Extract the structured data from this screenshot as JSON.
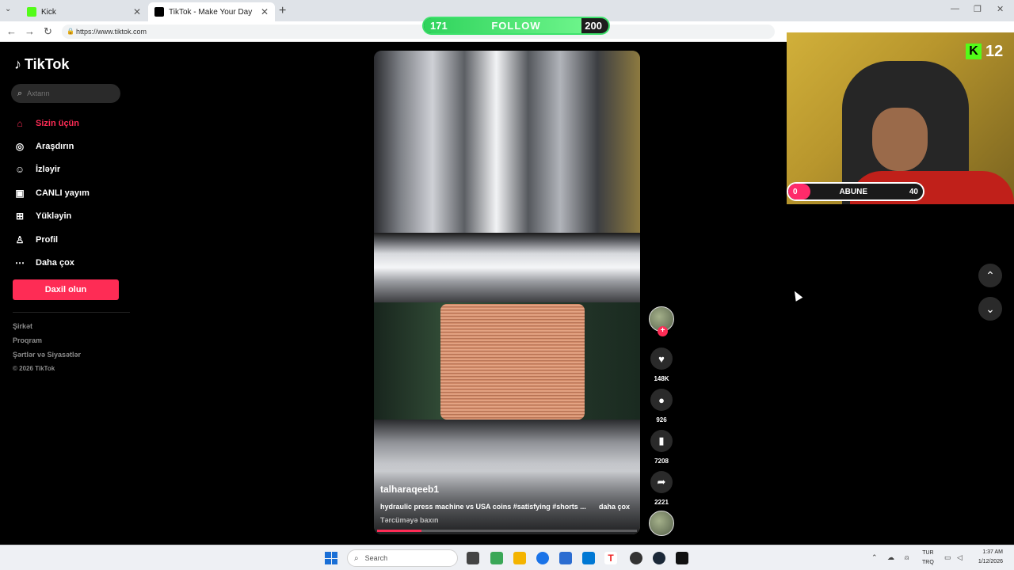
{
  "browser": {
    "tabs": [
      {
        "title": "Kick"
      },
      {
        "title": "TikTok - Make Your Day"
      }
    ],
    "url": "https://www.tiktok.com"
  },
  "follow_goal": {
    "current": "171",
    "label": "FOLLOW",
    "target": "200",
    "progress": 0.855
  },
  "sidebar": {
    "logo": "TikTok",
    "search_placeholder": "Axtarın",
    "nav": [
      {
        "label": "Sizin üçün",
        "icon": "home-icon"
      },
      {
        "label": "Araşdırın",
        "icon": "compass-icon"
      },
      {
        "label": "İzləyir",
        "icon": "following-icon"
      },
      {
        "label": "CANLI yayım",
        "icon": "live-icon"
      },
      {
        "label": "Yükləyin",
        "icon": "upload-icon"
      },
      {
        "label": "Profil",
        "icon": "profile-icon"
      },
      {
        "label": "Daha çox",
        "icon": "more-icon"
      }
    ],
    "login": "Daxil olun",
    "footer": [
      "Şirkət",
      "Proqram",
      "Şərtlər və Siyasətlər",
      "© 2026 TikTok"
    ]
  },
  "video": {
    "author": "talharaqeeb1",
    "description": "hydraulic press machine vs USA coins #satisfying #shorts ...",
    "more": "daha çox",
    "translate": "Tərcüməyə baxın",
    "progress": 0.17
  },
  "actions": {
    "likes": "148K",
    "comments": "926",
    "saves": "7208",
    "shares": "2221"
  },
  "stream_overlay": {
    "kick_count": "12",
    "sub_goal": {
      "current": "0",
      "label": "ABUNE",
      "target": "40"
    }
  },
  "taskbar": {
    "search": "Search",
    "lang": [
      "TUR",
      "TRQ"
    ],
    "time": "1:37 AM",
    "date": "1/12/2026"
  }
}
